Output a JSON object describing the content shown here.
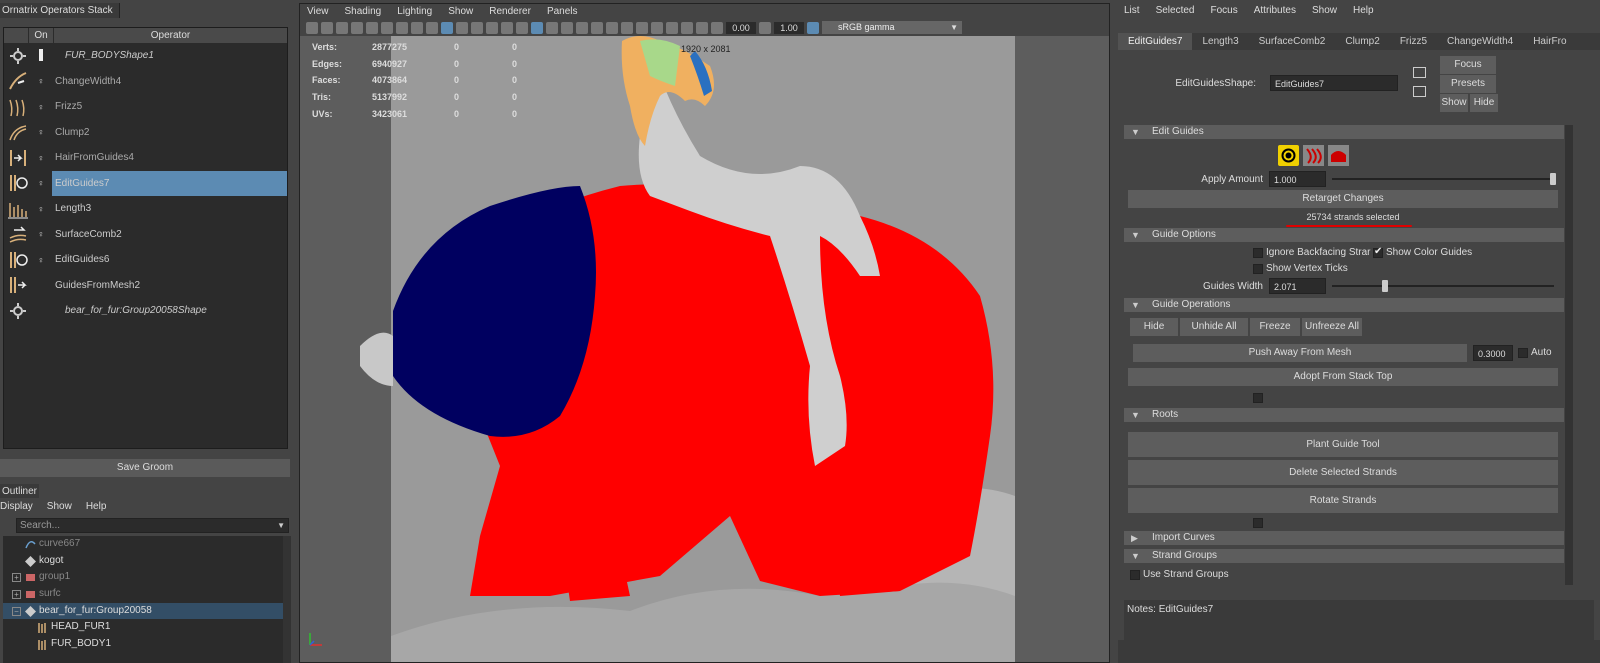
{
  "stack": {
    "title": "Ornatrix Operators Stack",
    "col_on": "On",
    "col_operator": "Operator",
    "operators": [
      {
        "label": "FUR_BODYShape1",
        "icon": "gear-icon"
      },
      {
        "label": "ChangeWidth4",
        "icon": "change-width-icon"
      },
      {
        "label": "Frizz5",
        "icon": "frizz-icon"
      },
      {
        "label": "Clump2",
        "icon": "clump-icon"
      },
      {
        "label": "HairFromGuides4",
        "icon": "hair-from-guides-icon"
      },
      {
        "label": "EditGuides7",
        "icon": "edit-guides-icon"
      },
      {
        "label": "Length3",
        "icon": "length-icon"
      },
      {
        "label": "SurfaceComb2",
        "icon": "surface-comb-icon"
      },
      {
        "label": "EditGuides6",
        "icon": "edit-guides-icon"
      },
      {
        "label": "GuidesFromMesh2",
        "icon": "guides-from-mesh-icon"
      },
      {
        "label": "bear_for_fur:Group20058Shape",
        "icon": "gear-icon"
      }
    ],
    "save_groom": "Save Groom"
  },
  "outliner": {
    "title": "Outliner",
    "menu": [
      "Display",
      "Show",
      "Help"
    ],
    "search_placeholder": "Search...",
    "items": [
      {
        "label": "curve667"
      },
      {
        "label": "kogot"
      },
      {
        "label": "group1"
      },
      {
        "label": "surfc"
      },
      {
        "label": "bear_for_fur:Group20058"
      },
      {
        "label": "HEAD_FUR1"
      },
      {
        "label": "FUR_BODY1"
      }
    ]
  },
  "viewport": {
    "menu": [
      "View",
      "Shading",
      "Lighting",
      "Show",
      "Renderer",
      "Panels"
    ],
    "exposure": "0.00",
    "gamma": "1.00",
    "color_space": "sRGB gamma",
    "resolution": "1920 x 2081",
    "hud": [
      {
        "label": "Verts:",
        "value": "2877275",
        "a": "0",
        "b": "0"
      },
      {
        "label": "Edges:",
        "value": "6940927",
        "a": "0",
        "b": "0"
      },
      {
        "label": "Faces:",
        "value": "4073864",
        "a": "0",
        "b": "0"
      },
      {
        "label": "Tris:",
        "value": "5137992",
        "a": "0",
        "b": "0"
      },
      {
        "label": "UVs:",
        "value": "3423061",
        "a": "0",
        "b": "0"
      }
    ]
  },
  "attr": {
    "menu": [
      "List",
      "Selected",
      "Focus",
      "Attributes",
      "Show",
      "Help"
    ],
    "tabs": [
      "EditGuides7",
      "Length3",
      "SurfaceComb2",
      "Clump2",
      "Frizz5",
      "ChangeWidth4",
      "HairFro"
    ],
    "shape_label": "EditGuidesShape:",
    "shape_value": "EditGuides7",
    "focus": "Focus",
    "presets": "Presets",
    "show": "Show",
    "hide": "Hide",
    "edit_guides": "Edit Guides",
    "apply_amount_label": "Apply Amount",
    "apply_amount": "1.000",
    "retarget": "Retarget Changes",
    "strands_selected": "25734 strands selected",
    "guide_options": "Guide Options",
    "ignore_backfacing": "Ignore Backfacing Strar",
    "show_color_guides": "Show Color Guides",
    "show_vertex_ticks": "Show Vertex Ticks",
    "guides_width_label": "Guides Width",
    "guides_width": "2.071",
    "guide_operations": "Guide Operations",
    "op_hide": "Hide",
    "op_unhide_all": "Unhide All",
    "op_freeze": "Freeze",
    "op_unfreeze_all": "Unfreeze All",
    "push_away": "Push Away From Mesh",
    "push_value": "0.3000",
    "auto": "Auto",
    "adopt": "Adopt From Stack Top",
    "roots": "Roots",
    "plant_tool": "Plant Guide Tool",
    "delete_strands": "Delete Selected Strands",
    "rotate_strands": "Rotate Strands",
    "import_curves": "Import Curves",
    "strand_groups": "Strand Groups",
    "use_strand_groups": "Use Strand Groups",
    "notes_label": "Notes:",
    "notes_value": "EditGuides7"
  }
}
